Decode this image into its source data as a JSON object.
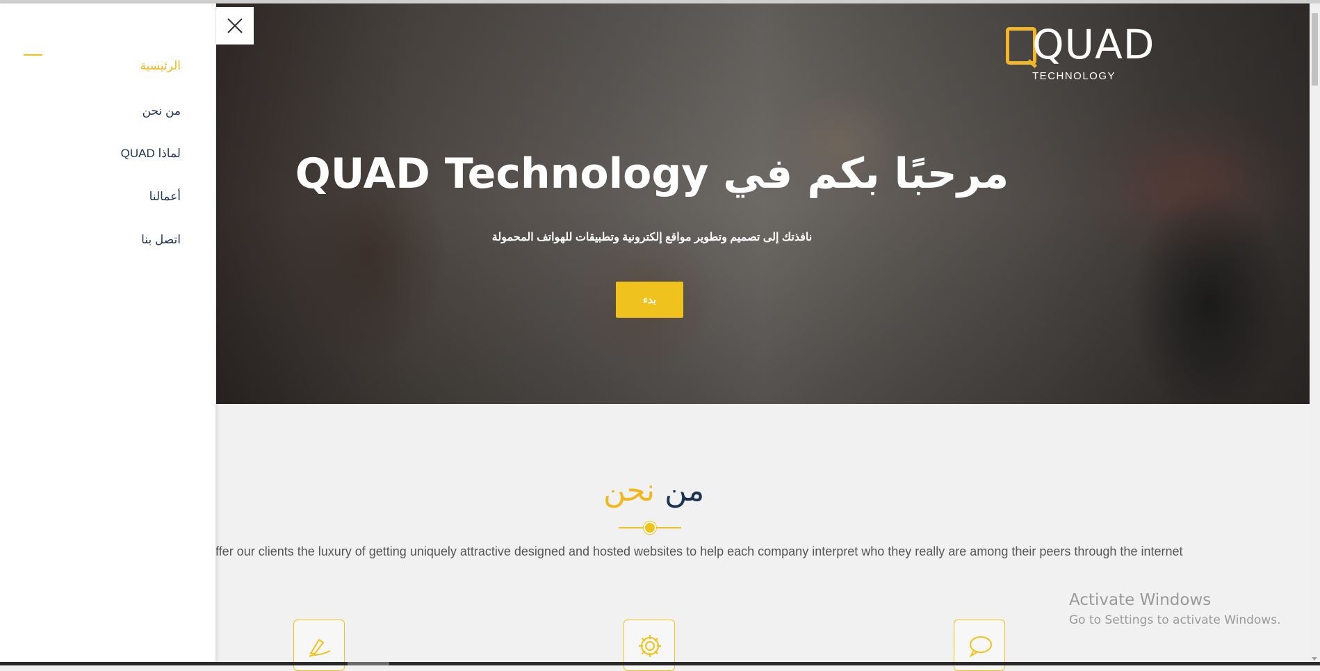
{
  "brand": {
    "logo_letters": "QUAD",
    "subtitle": "TECHNOLOGY",
    "accent_color": "#f0c21e"
  },
  "hero": {
    "title": "مرحبًا بكم في QUAD Technology",
    "subtitle": "نافذتك إلى تصميم وتطوير مواقع إلكترونية وتطبيقات للهواتف المحمولة",
    "cta_label": "بدء"
  },
  "menu": {
    "items": [
      {
        "label": "الرئيسية",
        "active": true
      },
      {
        "label": "من نحن",
        "active": false
      },
      {
        "label": "لماذا QUAD",
        "active": false
      },
      {
        "label": "أعمالنا",
        "active": false
      },
      {
        "label": "اتصل بنا",
        "active": false
      }
    ],
    "close_icon": "close-icon"
  },
  "about": {
    "title_part1": "من",
    "title_part2": "نحن",
    "description": "ffer our clients the luxury of getting uniquely attractive designed and hosted websites to help each company interpret who they really are among their peers through the internet",
    "features": [
      {
        "icon": "pen-sign-icon"
      },
      {
        "icon": "gear-icon"
      },
      {
        "icon": "chat-bubble-icon"
      }
    ]
  },
  "watermark": {
    "line1": "Activate Windows",
    "line2": "Go to Settings to activate Windows."
  }
}
